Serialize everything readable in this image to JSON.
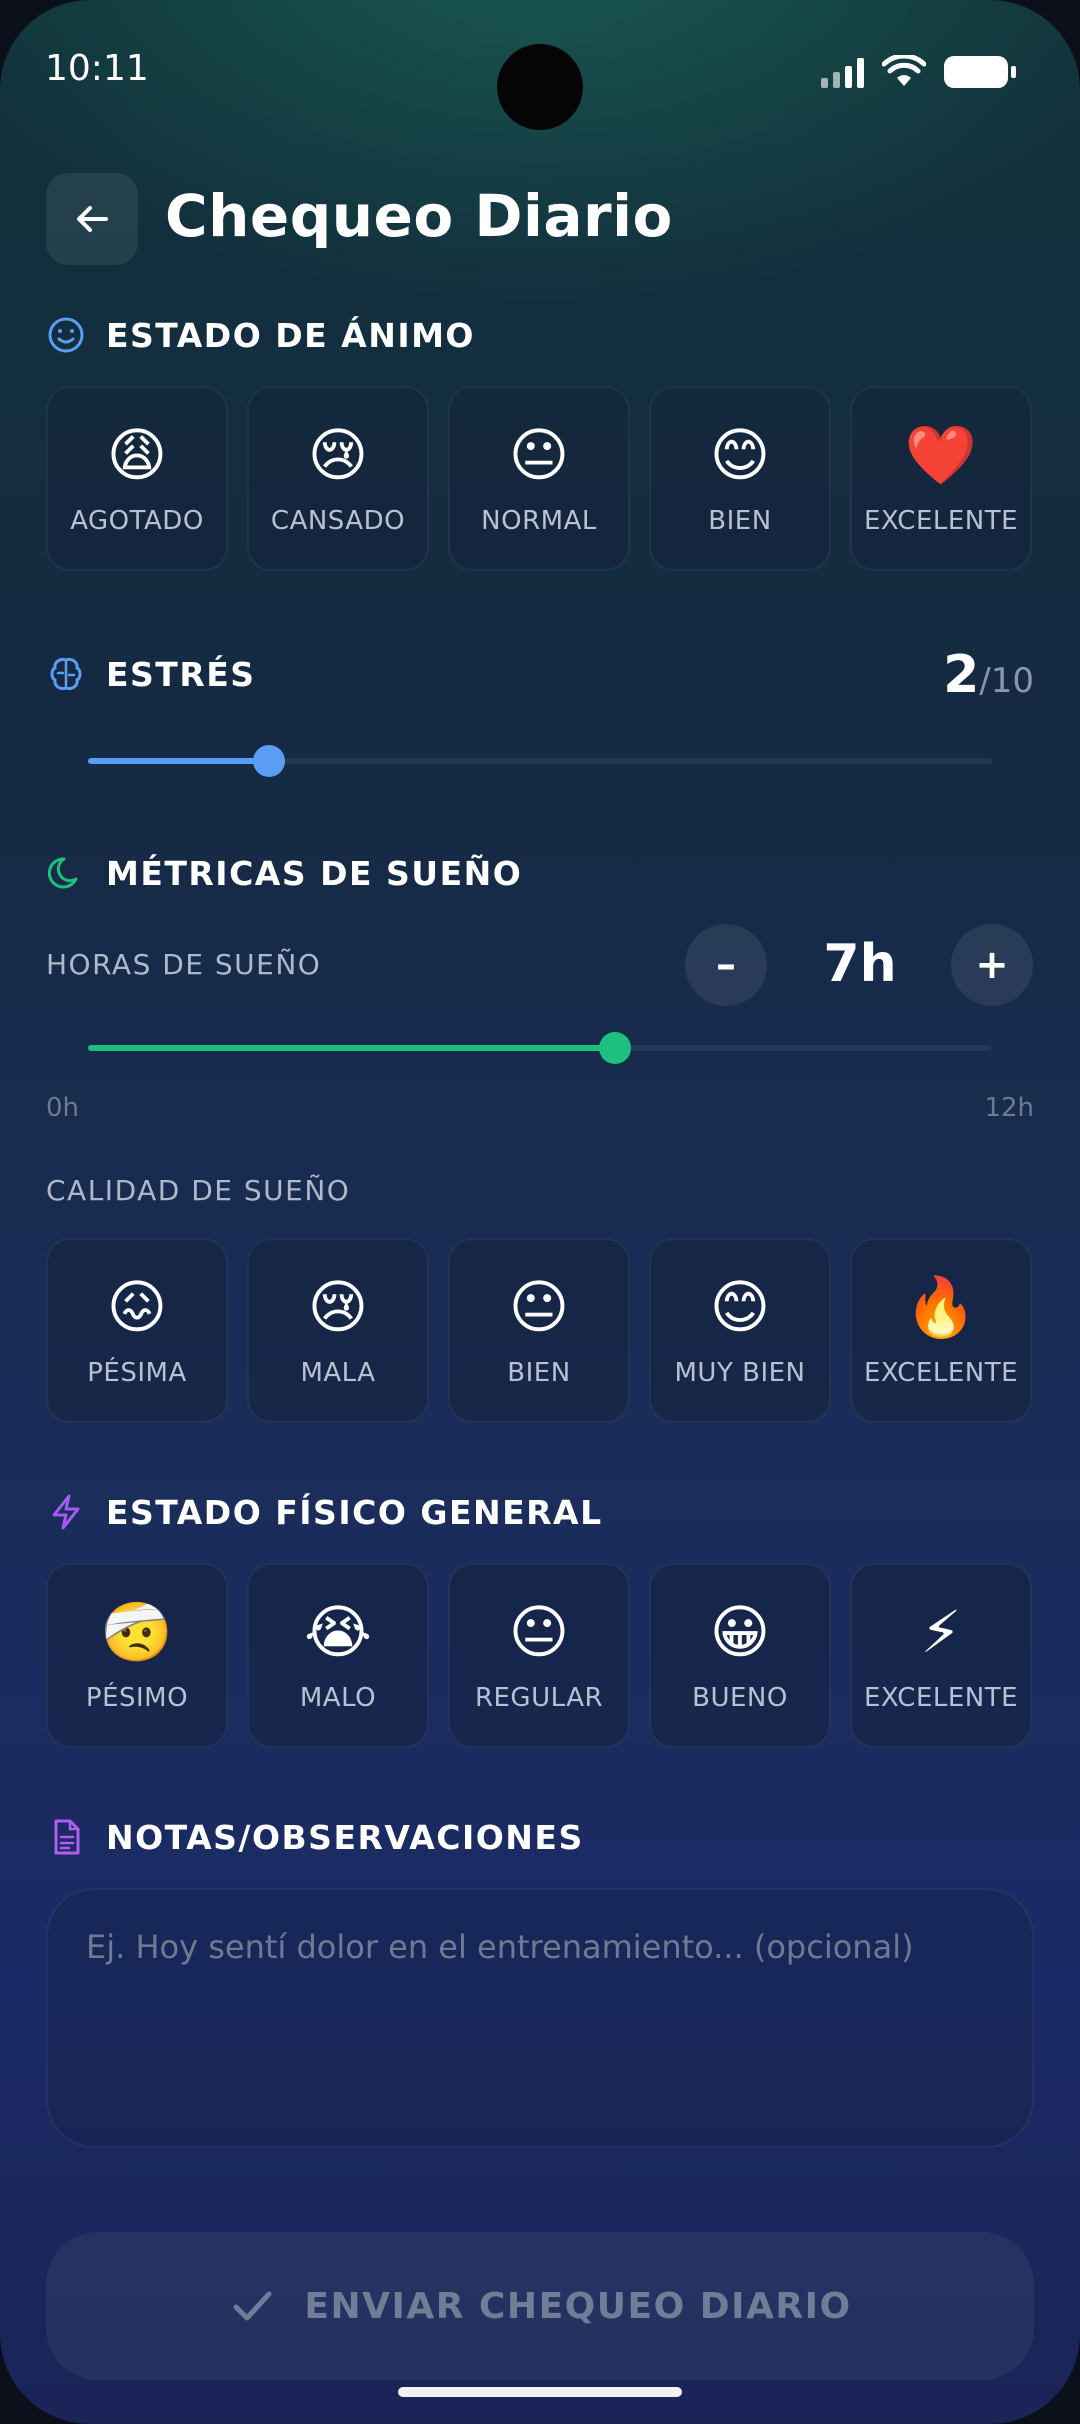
{
  "status_bar": {
    "time": "10:11"
  },
  "header": {
    "title": "Chequeo Diario"
  },
  "mood": {
    "title": "ESTADO DE ÁNIMO",
    "options": [
      {
        "emoji": "😩",
        "label": "AGOTADO"
      },
      {
        "emoji": "😢",
        "label": "CANSADO"
      },
      {
        "emoji": "😐",
        "label": "NORMAL"
      },
      {
        "emoji": "😊",
        "label": "BIEN"
      },
      {
        "emoji": "❤️",
        "label": "EXCELENTE"
      }
    ]
  },
  "stress": {
    "title": "ESTRÉS",
    "value": "2",
    "max": "/10",
    "fraction": 0.2
  },
  "sleep": {
    "title": "MÉTRICAS DE SUEÑO",
    "hours_label": "HORAS DE SUEÑO",
    "hours_value": "7h",
    "minus": "–",
    "plus": "+",
    "hours_fraction": 0.5833,
    "range_min": "0h",
    "range_max": "12h",
    "quality_label": "CALIDAD DE SUEÑO",
    "quality_options": [
      {
        "emoji": "😖",
        "label": "PÉSIMA"
      },
      {
        "emoji": "😢",
        "label": "MALA"
      },
      {
        "emoji": "😐",
        "label": "BIEN"
      },
      {
        "emoji": "😊",
        "label": "MUY BIEN"
      },
      {
        "emoji": "🔥",
        "label": "EXCELENTE"
      }
    ]
  },
  "physical": {
    "title": "ESTADO FÍSICO GENERAL",
    "options": [
      {
        "emoji": "🤕",
        "label": "PÉSIMO"
      },
      {
        "emoji": "😭",
        "label": "MALO"
      },
      {
        "emoji": "😐",
        "label": "REGULAR"
      },
      {
        "emoji": "😀",
        "label": "BUENO"
      },
      {
        "emoji": "⚡",
        "label": "EXCELENTE"
      }
    ]
  },
  "notes": {
    "title": "NOTAS/OBSERVACIONES",
    "placeholder": "Ej. Hoy sentí dolor en el entrenamiento... (opcional)"
  },
  "submit": {
    "label": "ENVIAR CHEQUEO DIARIO"
  },
  "colors": {
    "stress_accent": "#5b9cf5",
    "sleep_accent": "#1fbf7f",
    "physical_accent": "#a35cf0",
    "notes_accent": "#b25cf0"
  }
}
